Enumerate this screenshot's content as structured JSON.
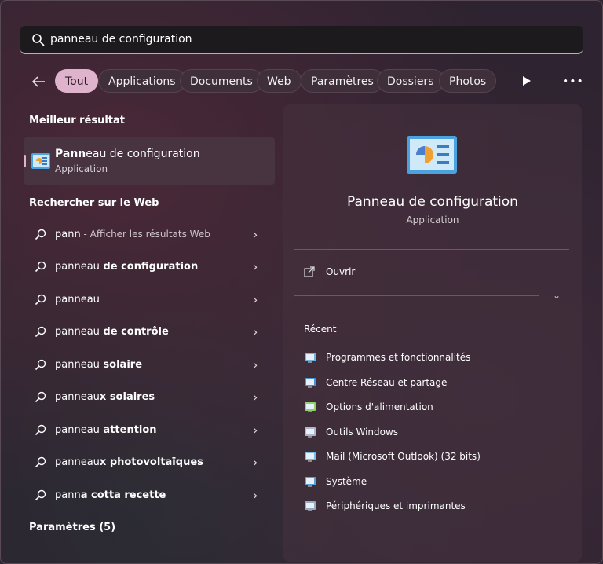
{
  "search": {
    "query": "panneau de configuration"
  },
  "filters": [
    "Tout",
    "Applications",
    "Documents",
    "Web",
    "Paramètres",
    "Dossiers",
    "Photos"
  ],
  "best_match": {
    "heading": "Meilleur résultat",
    "title": "Panneau de configuration",
    "title_bold": "Pann",
    "title_rest": "eau de configuration",
    "subtitle": "Application"
  },
  "web": {
    "heading": "Rechercher sur le Web",
    "items": [
      {
        "prefix": "pann",
        "bold": "",
        "hint": " - Afficher les résultats Web"
      },
      {
        "prefix": "panneau",
        "bold": " de configuration",
        "hint": ""
      },
      {
        "prefix": "panneau",
        "bold": "",
        "hint": ""
      },
      {
        "prefix": "panneau",
        "bold": " de contrôle",
        "hint": ""
      },
      {
        "prefix": "panneau",
        "bold": " solaire",
        "hint": ""
      },
      {
        "prefix": "panneau",
        "bold": "x solaires",
        "hint": ""
      },
      {
        "prefix": "panneau",
        "bold": " attention",
        "hint": ""
      },
      {
        "prefix": "panneau",
        "bold": "x photovoltaïques",
        "hint": ""
      },
      {
        "prefix": "pann",
        "bold": "a cotta recette",
        "hint": ""
      }
    ]
  },
  "settings": {
    "heading": "Paramètres (5)"
  },
  "detail": {
    "title": "Panneau de configuration",
    "subtitle": "Application",
    "open_label": "Ouvrir",
    "recent_heading": "Récent",
    "recent": [
      "Programmes et fonctionnalités",
      "Centre Réseau et partage",
      "Options d'alimentation",
      "Outils Windows",
      "Mail (Microsoft Outlook) (32 bits)",
      "Système",
      "Périphériques et imprimantes"
    ]
  },
  "colors": {
    "accent": "#e0b3cc",
    "panel": "#2e2330"
  }
}
